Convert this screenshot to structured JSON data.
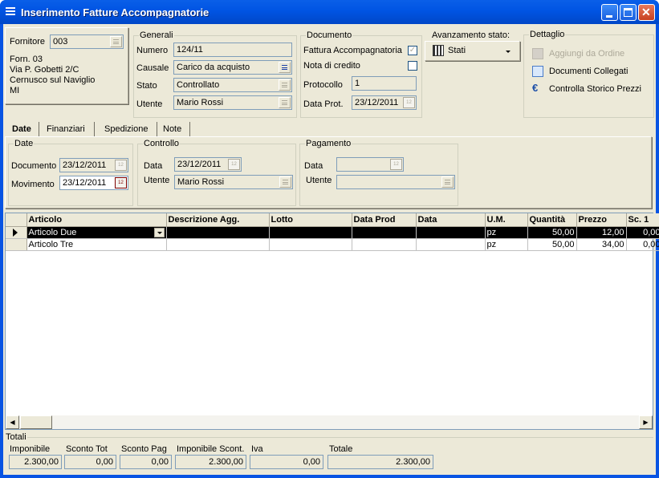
{
  "window": {
    "title": "Inserimento Fatture Accompagnatorie"
  },
  "fornitore": {
    "label": "Fornitore",
    "code": "003",
    "address": [
      "Forn. 03",
      "Via P. Gobetti 2/C",
      "Cernusco sul Naviglio",
      "MI"
    ]
  },
  "generali": {
    "title": "Generali",
    "numero_label": "Numero",
    "numero": "124/11",
    "causale_label": "Causale",
    "causale": "Carico da acquisto",
    "stato_label": "Stato",
    "stato": "Controllato",
    "utente_label": "Utente",
    "utente": "Mario Rossi"
  },
  "documento": {
    "title": "Documento",
    "fattura_label": "Fattura Accompagnatoria",
    "fattura_checked": true,
    "nota_label": "Nota di credito",
    "nota_checked": false,
    "protocollo_label": "Protocollo",
    "protocollo": "1",
    "dataprot_label": "Data Prot.",
    "dataprot": "23/12/2011"
  },
  "avanzamento": {
    "title": "Avanzamento stato:",
    "button_label": "Stati"
  },
  "dettaglio": {
    "title": "Dettaglio",
    "items": [
      "Aggiungi da Ordine",
      "Documenti Collegati",
      "Controlla Storico Prezzi"
    ]
  },
  "tabs": [
    "Date",
    "Finanziari",
    "Spedizione",
    "Note"
  ],
  "date_group": {
    "title": "Date",
    "documento_label": "Documento",
    "documento": "23/12/2011",
    "movimento_label": "Movimento",
    "movimento": "23/12/2011"
  },
  "controllo": {
    "title": "Controllo",
    "data_label": "Data",
    "data": "23/12/2011",
    "utente_label": "Utente",
    "utente": "Mario Rossi"
  },
  "pagamento": {
    "title": "Pagamento",
    "data_label": "Data",
    "data": "",
    "utente_label": "Utente",
    "utente": ""
  },
  "grid": {
    "columns": [
      "Articolo",
      "Descrizione Agg.",
      "Lotto",
      "Data Prod",
      "Data",
      "U.M.",
      "Quantità",
      "Prezzo",
      "Sc. 1"
    ],
    "rows": [
      [
        "Articolo Due",
        "",
        "",
        "",
        "",
        "pz",
        "50,00",
        "12,00",
        "0,00"
      ],
      [
        "Articolo Tre",
        "",
        "",
        "",
        "",
        "pz",
        "50,00",
        "34,00",
        "0,00"
      ]
    ]
  },
  "totali": {
    "title": "Totali",
    "imponibile_label": "Imponibile",
    "imponibile": "2.300,00",
    "scontotot_label": "Sconto Tot",
    "scontotot": "0,00",
    "scontopag_label": "Sconto Pag",
    "scontopag": "0,00",
    "impscont_label": "Imponibile Scont.",
    "impscont": "2.300,00",
    "iva_label": "Iva",
    "iva": "0,00",
    "totale_label": "Totale",
    "totale": "2.300,00"
  },
  "colors": {
    "titlebar": "#0054e3",
    "panel": "#ece9d8",
    "selected_row": "#000000"
  }
}
